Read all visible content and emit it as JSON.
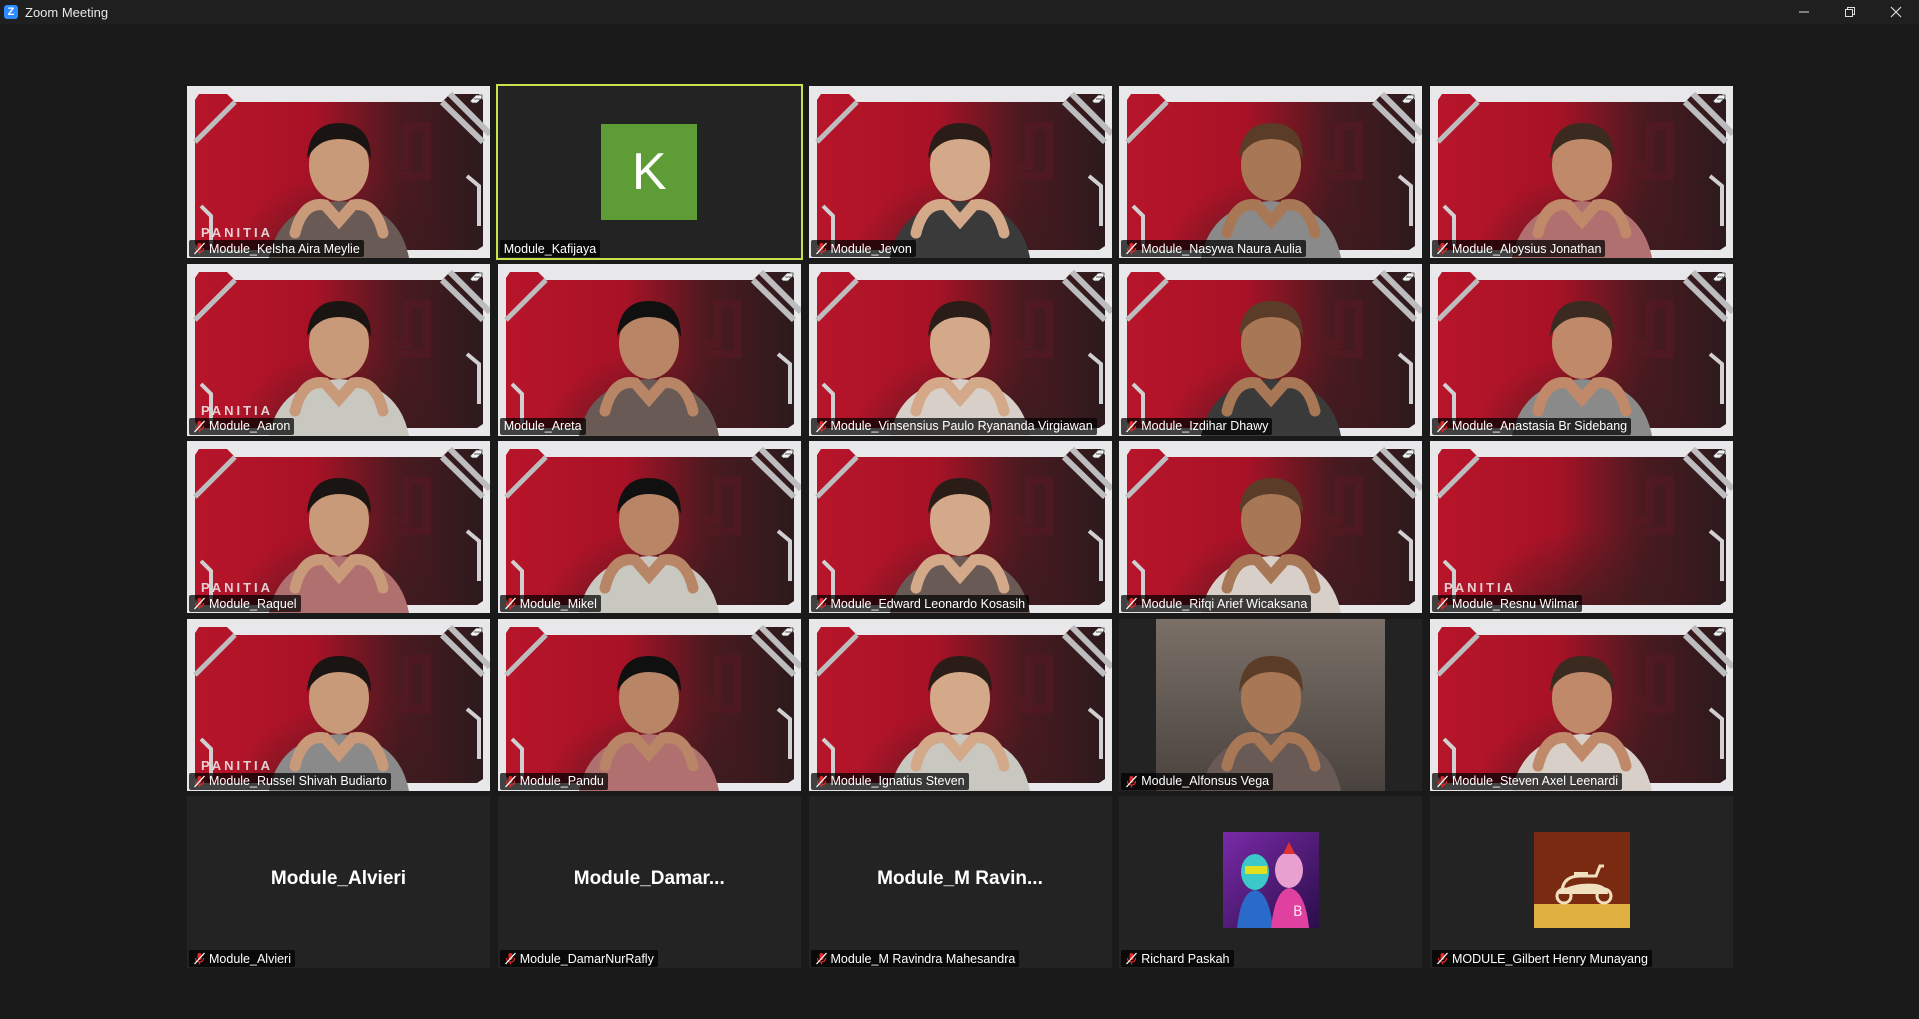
{
  "window": {
    "title": "Zoom Meeting",
    "logo": "Z"
  },
  "accent_color": "#c6e34d",
  "tile_background_text": "PANITIA",
  "participants": [
    {
      "name": "Module_Kelsha Aira Meylie",
      "type": "video",
      "muted": true
    },
    {
      "name": "Module_Kafijaya",
      "type": "letter",
      "letter": "K",
      "muted": false,
      "active": true
    },
    {
      "name": "Module_Jevon",
      "type": "video",
      "muted": true
    },
    {
      "name": "Module_Nasywa Naura Aulia",
      "type": "video",
      "muted": true
    },
    {
      "name": "Module_Aloysius Jonathan",
      "type": "video",
      "muted": true
    },
    {
      "name": "Module_Aaron",
      "type": "video",
      "muted": true
    },
    {
      "name": "Module_Areta",
      "type": "video",
      "muted": false
    },
    {
      "name": "Module_Vinsensius Paulo Ryananda Virgiawan",
      "type": "video",
      "muted": true
    },
    {
      "name": "Module_Izdihar Dhawy",
      "type": "video",
      "muted": true
    },
    {
      "name": "Module_Anastasia Br Sidebang",
      "type": "video",
      "muted": true
    },
    {
      "name": "Module_Raquel",
      "type": "video",
      "muted": true
    },
    {
      "name": "Module_Mikel",
      "type": "video",
      "muted": true
    },
    {
      "name": "Module_Edward Leonardo Kosasih",
      "type": "video",
      "muted": true
    },
    {
      "name": "Module_Rifqi Arief Wicaksana",
      "type": "video",
      "muted": true
    },
    {
      "name": "Module_Resnu Wilmar",
      "type": "video",
      "muted": true
    },
    {
      "name": "Module_Russel Shivah Budiarto",
      "type": "video",
      "muted": true
    },
    {
      "name": "Module_Pandu",
      "type": "video",
      "muted": true
    },
    {
      "name": "Module_Ignatius Steven",
      "type": "video",
      "muted": true
    },
    {
      "name": "Module_Alfonsus Vega",
      "type": "plainvideo",
      "muted": true
    },
    {
      "name": "Module_Steven Axel Leenardi",
      "type": "video",
      "muted": true
    },
    {
      "name": "Module_Alvieri",
      "type": "noname",
      "display": "Module_Alvieri",
      "muted": true
    },
    {
      "name": "Module_DamarNurRafly",
      "type": "noname",
      "display": "Module_Damar...",
      "muted": true
    },
    {
      "name": "Module_M Ravindra Mahesandra",
      "type": "noname",
      "display": "Module_M  Ravin...",
      "muted": true
    },
    {
      "name": "Richard Paskah",
      "type": "image",
      "image": "cartoon-avatar",
      "muted": true
    },
    {
      "name": "MODULE_Gilbert Henry Munayang",
      "type": "image",
      "image": "scooter-avatar",
      "muted": true
    }
  ]
}
